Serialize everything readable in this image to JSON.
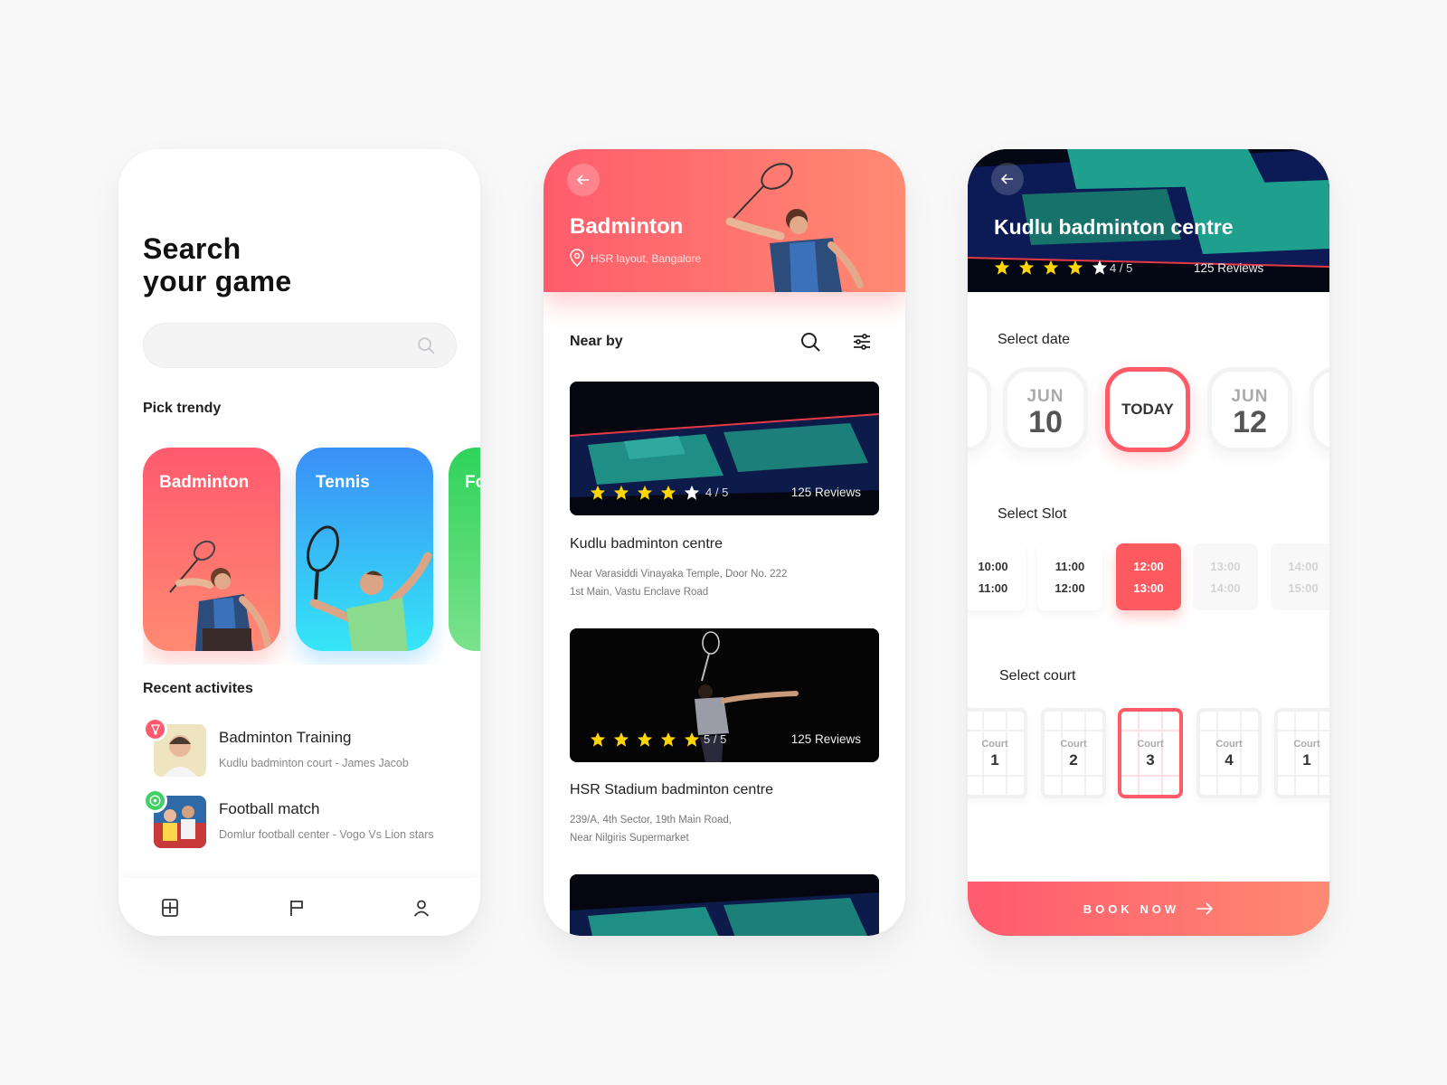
{
  "colors": {
    "accent": "#ff5a66",
    "star": "#ffd600"
  },
  "screen1": {
    "title_line1": "Search",
    "title_line2": "your game",
    "search_placeholder": "",
    "pick_trendy": "Pick trendy",
    "cards": [
      "Badminton",
      "Tennis",
      "Fo"
    ],
    "recent_title": "Recent activites",
    "activities": [
      {
        "title": "Badminton Training",
        "subtitle": "Kudlu badminton court - James Jacob",
        "icon": "shuttlecock-icon"
      },
      {
        "title": "Football match",
        "subtitle": "Domlur football  center - Vogo Vs Lion stars",
        "icon": "football-icon"
      }
    ],
    "nav": [
      "home-icon",
      "flag-icon",
      "user-icon"
    ]
  },
  "screen2": {
    "title": "Badminton",
    "location": "HSR layout, Bangalore",
    "nearby": "Near by",
    "venues": [
      {
        "name": "Kudlu badminton centre",
        "address1": "Near Varasiddi Vinayaka Temple, Door No. 222",
        "address2": "1st Main, Vastu Enclave Road",
        "rating": "4 / 5",
        "stars": 4,
        "reviews": "125 Reviews"
      },
      {
        "name": "HSR Stadium badminton centre",
        "address1": "239/A, 4th Sector, 19th Main Road,",
        "address2": "Near Nilgiris Supermarket",
        "rating": "5 / 5",
        "stars": 5,
        "reviews": "125 Reviews"
      }
    ]
  },
  "screen3": {
    "title": "Kudlu badminton centre",
    "rating": "4 / 5",
    "stars": 4,
    "reviews": "125 Reviews",
    "select_date": "Select date",
    "dates": [
      {
        "month": "JUN",
        "day": "10"
      },
      {
        "today": "TODAY"
      },
      {
        "month": "JUN",
        "day": "12"
      }
    ],
    "select_slot": "Select Slot",
    "slots": [
      {
        "from": "10:00",
        "to": "11:00"
      },
      {
        "from": "11:00",
        "to": "12:00"
      },
      {
        "from": "12:00",
        "to": "13:00"
      },
      {
        "from": "13:00",
        "to": "14:00"
      },
      {
        "from": "14:00",
        "to": "15:00"
      }
    ],
    "select_court": "Select court",
    "court_label": "Court",
    "courts": [
      "1",
      "2",
      "3",
      "4",
      "1"
    ],
    "book_label": "BOOK NOW"
  }
}
